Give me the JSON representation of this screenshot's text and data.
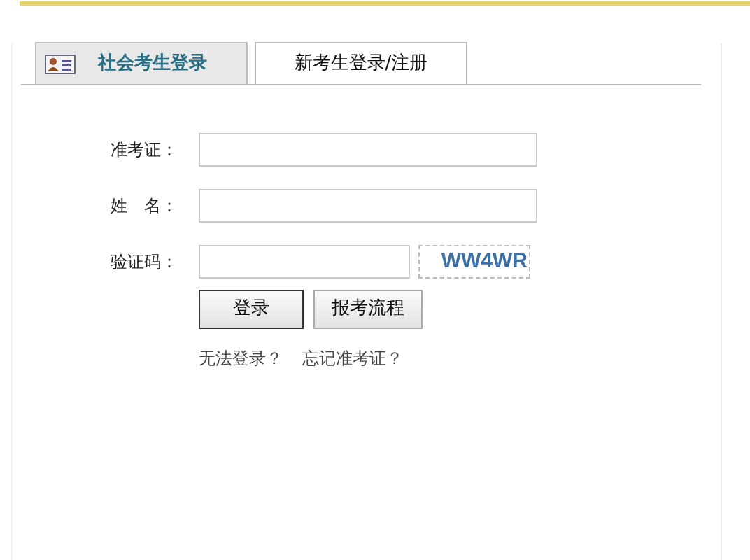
{
  "tabs": [
    {
      "label": "社会考生登录",
      "selected": true,
      "icon": true
    },
    {
      "label": "新考生登录/注册",
      "selected": false,
      "icon": false
    }
  ],
  "fields": [
    {
      "label": "准考证：",
      "kind": "text"
    },
    {
      "label": "姓　名：",
      "kind": "text"
    },
    {
      "label": "验证码：",
      "kind": "captcha",
      "captcha": "WW4WR"
    }
  ],
  "buttons": [
    {
      "label": "登录",
      "primary": true
    },
    {
      "label": "报考流程",
      "primary": false
    }
  ],
  "links": [
    "无法登录？",
    "忘记准考证？"
  ]
}
